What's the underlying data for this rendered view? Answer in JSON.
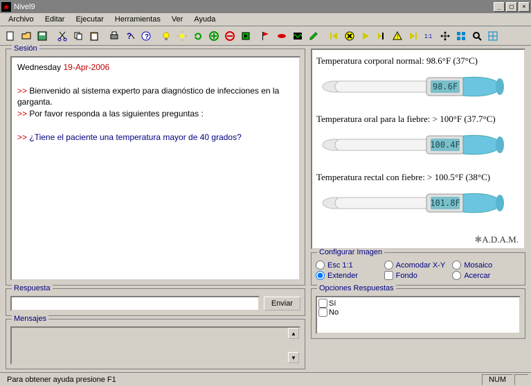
{
  "window": {
    "title": "Nivel9"
  },
  "menu": {
    "items": [
      "Archivo",
      "Editar",
      "Ejecutar",
      "Herramientas",
      "Ver",
      "Ayuda"
    ]
  },
  "session": {
    "legend": "Sesión",
    "weekday": "Wednesday",
    "date": "19-Apr-",
    "year": "2006",
    "welcome1": "Bienvenido al sistema experto para diagnóstico de infecciones en la garganta.",
    "welcome2": "Por favor responda a las siguientes preguntas :",
    "question": "¿Tiene el paciente una temperatura mayor de 40 grados?"
  },
  "respuesta": {
    "legend": "Respuesta",
    "send": "Enviar"
  },
  "mensajes": {
    "legend": "Mensajes"
  },
  "thermos": {
    "t1_label": "Temperatura corporal normal: 98.6°F (37°C)",
    "t1_value": "98.6F",
    "t2_label": "Temperatura oral para la fiebre: > 100°F (37.7°C)",
    "t2_value": "100.4F",
    "t3_label": "Temperatura rectal con fiebre: > 100.5°F (38°C)",
    "t3_value": "101.8F",
    "logo": "A.D.A.M."
  },
  "config": {
    "legend": "Configurar Imagen",
    "esc11": "Esc 1:1",
    "acomodar": "Acomodar X-Y",
    "mosaico": "Mosaico",
    "extender": "Extender",
    "fondo": "Fondo",
    "acercar": "Acercar"
  },
  "opciones": {
    "legend": "Opciones Respuestas",
    "si": "Sí",
    "no": "No"
  },
  "status": {
    "help": "Para obtener ayuda presione F1",
    "num": "NUM"
  }
}
